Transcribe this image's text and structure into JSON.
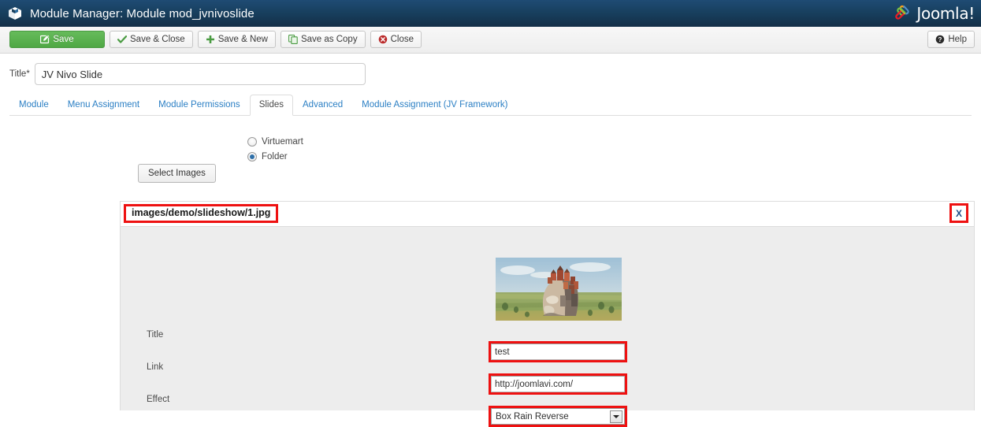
{
  "header": {
    "icon": "cube-icon",
    "title": "Module Manager: Module mod_jvnivoslide",
    "brand": "Joomla!",
    "brand_tm": "®",
    "bg_color": "#18405f"
  },
  "toolbar": {
    "buttons": [
      {
        "label": "Save",
        "icon": "pencil-square-icon",
        "style": "primary"
      },
      {
        "label": "Save & Close",
        "icon": "check-icon",
        "style": "default"
      },
      {
        "label": "Save & New",
        "icon": "plus-icon",
        "style": "default"
      },
      {
        "label": "Save as Copy",
        "icon": "copy-icon",
        "style": "default"
      },
      {
        "label": "Close",
        "icon": "close-circle-icon",
        "style": "default"
      }
    ],
    "help_label": "Help",
    "help_icon": "question-circle-icon",
    "primary_color": "#4fa844"
  },
  "title_field": {
    "label": "Title",
    "required_mark": "*",
    "value": "JV Nivo Slide",
    "placeholder": ""
  },
  "tabs": [
    {
      "label": "Module",
      "active": false
    },
    {
      "label": "Menu Assignment",
      "active": false
    },
    {
      "label": "Module Permissions",
      "active": false
    },
    {
      "label": "Slides",
      "active": true
    },
    {
      "label": "Advanced",
      "active": false
    },
    {
      "label": "Module Assignment (JV Framework)",
      "active": false
    }
  ],
  "source": {
    "options": [
      {
        "label": "Virtuemart",
        "checked": false
      },
      {
        "label": "Folder",
        "checked": true
      }
    ],
    "select_images_label": "Select Images"
  },
  "slide": {
    "path": "images/demo/slideshow/1.jpg",
    "close_label": "X",
    "thumbnail_alt": "surreal-rock-village-landscape",
    "fields": [
      {
        "label": "Title",
        "type": "text",
        "value": "test"
      },
      {
        "label": "Link",
        "type": "text",
        "value": "http://joomlavi.com/"
      },
      {
        "label": "Effect",
        "type": "select",
        "value": "Box Rain Reverse"
      }
    ],
    "highlight_color": "#ee1111"
  }
}
